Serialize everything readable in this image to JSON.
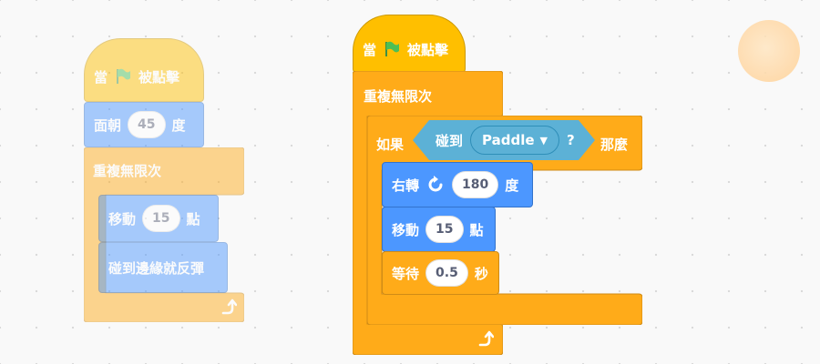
{
  "left_script": {
    "hat": {
      "when": "當",
      "clicked": "被點擊"
    },
    "point": {
      "label": "面朝",
      "value": "45",
      "unit": "度"
    },
    "forever": {
      "label": "重複無限次"
    },
    "move": {
      "label": "移動",
      "value": "15",
      "unit": "點"
    },
    "bounce": {
      "label": "碰到邊緣就反彈"
    }
  },
  "right_script": {
    "hat": {
      "when": "當",
      "clicked": "被點擊"
    },
    "forever": {
      "label": "重複無限次"
    },
    "if": {
      "label": "如果",
      "then": "那麼"
    },
    "touching": {
      "label": "碰到",
      "target": "Paddle",
      "question": "?"
    },
    "turn": {
      "label": "右轉",
      "value": "180",
      "unit": "度"
    },
    "move": {
      "label": "移動",
      "value": "15",
      "unit": "點"
    },
    "wait": {
      "label": "等待",
      "value": "0.5",
      "unit": "秒"
    }
  },
  "icons": [
    "green-flag-icon",
    "loop-arrow-icon",
    "turn-right-icon",
    "dropdown-caret-icon"
  ],
  "colors": {
    "events": "#ffbf00",
    "control": "#ffab19",
    "motion": "#4c97ff",
    "sensing": "#5cb1d6",
    "flag": "#4cbf56"
  }
}
